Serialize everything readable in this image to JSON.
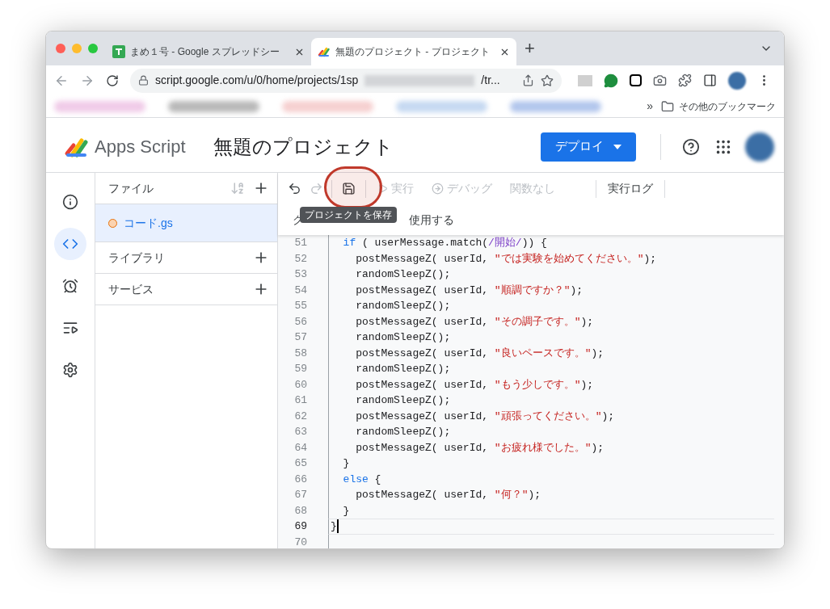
{
  "browser": {
    "tabs": [
      {
        "title": "まめ１号 - Google スプレッドシー",
        "kind": "sheets",
        "selected": false
      },
      {
        "title": "無題のプロジェクト - プロジェクト",
        "kind": "script",
        "selected": true
      }
    ],
    "new_tab": "+",
    "url_start": "script.google.com/u/0/home/projects/1sp",
    "url_end": "/tr...",
    "bookmarks_overflow": "»",
    "other_bookmarks": "その他のブックマーク"
  },
  "app": {
    "name": "Apps Script",
    "project_title": "無題のプロジェクト",
    "deploy_button": "デプロイ"
  },
  "rail": [
    {
      "kind": "overview",
      "selected": false
    },
    {
      "kind": "editor",
      "selected": true
    },
    {
      "kind": "triggers",
      "selected": false
    },
    {
      "kind": "executions",
      "selected": false
    },
    {
      "kind": "settings",
      "selected": false
    }
  ],
  "files": {
    "heading": "ファイル",
    "items": [
      {
        "name": "コード.gs",
        "selected": true
      }
    ],
    "sections": [
      "ライブラリ",
      "サービス"
    ]
  },
  "toolbar": {
    "actions": [
      {
        "kind": "undo",
        "disabled": false
      },
      {
        "kind": "redo",
        "disabled": true
      },
      {
        "kind": "save",
        "disabled": false
      }
    ],
    "run": {
      "label": "実行",
      "disabled": true
    },
    "debug": {
      "label": "デバッグ",
      "disabled": true
    },
    "function_select": "関数なし",
    "log_button": "実行ログ",
    "hint_start": "ク",
    "hint_end": "使用する",
    "tooltip": "プロジェクトを保存"
  },
  "code_lines": [
    {
      "number": "51",
      "current": false,
      "segments": [
        {
          "kind": "keyword",
          "text": "  if"
        },
        {
          "kind": "plain",
          "text": " ( userMessage.match("
        },
        {
          "kind": "regex",
          "text": "/開始/"
        },
        {
          "kind": "plain",
          "text": ")) {"
        }
      ]
    },
    {
      "number": "52",
      "current": false,
      "segments": [
        {
          "kind": "plain",
          "text": "    postMessageZ( userId, "
        },
        {
          "kind": "string",
          "text": "\"では実験を始めてください。\""
        },
        {
          "kind": "plain",
          "text": ");"
        }
      ]
    },
    {
      "number": "53",
      "current": false,
      "segments": [
        {
          "kind": "plain",
          "text": "    randomSleepZ();"
        }
      ]
    },
    {
      "number": "54",
      "current": false,
      "segments": [
        {
          "kind": "plain",
          "text": "    postMessageZ( userId, "
        },
        {
          "kind": "string",
          "text": "\"順調ですか？\""
        },
        {
          "kind": "plain",
          "text": ");"
        }
      ]
    },
    {
      "number": "55",
      "current": false,
      "segments": [
        {
          "kind": "plain",
          "text": "    randomSleepZ();"
        }
      ]
    },
    {
      "number": "56",
      "current": false,
      "segments": [
        {
          "kind": "plain",
          "text": "    postMessageZ( userId, "
        },
        {
          "kind": "string",
          "text": "\"その調子です。\""
        },
        {
          "kind": "plain",
          "text": ");"
        }
      ]
    },
    {
      "number": "57",
      "current": false,
      "segments": [
        {
          "kind": "plain",
          "text": "    randomSleepZ();"
        }
      ]
    },
    {
      "number": "58",
      "current": false,
      "segments": [
        {
          "kind": "plain",
          "text": "    postMessageZ( userId, "
        },
        {
          "kind": "string",
          "text": "\"良いペースです。\""
        },
        {
          "kind": "plain",
          "text": ");"
        }
      ]
    },
    {
      "number": "59",
      "current": false,
      "segments": [
        {
          "kind": "plain",
          "text": "    randomSleepZ();"
        }
      ]
    },
    {
      "number": "60",
      "current": false,
      "segments": [
        {
          "kind": "plain",
          "text": "    postMessageZ( userId, "
        },
        {
          "kind": "string",
          "text": "\"もう少しです。\""
        },
        {
          "kind": "plain",
          "text": ");"
        }
      ]
    },
    {
      "number": "61",
      "current": false,
      "segments": [
        {
          "kind": "plain",
          "text": "    randomSleepZ();"
        }
      ]
    },
    {
      "number": "62",
      "current": false,
      "segments": [
        {
          "kind": "plain",
          "text": "    postMessageZ( userId, "
        },
        {
          "kind": "string",
          "text": "\"頑張ってください。\""
        },
        {
          "kind": "plain",
          "text": ");"
        }
      ]
    },
    {
      "number": "63",
      "current": false,
      "segments": [
        {
          "kind": "plain",
          "text": "    randomSleepZ();"
        }
      ]
    },
    {
      "number": "64",
      "current": false,
      "segments": [
        {
          "kind": "plain",
          "text": "    postMessageZ( userId, "
        },
        {
          "kind": "string",
          "text": "\"お疲れ様でした。\""
        },
        {
          "kind": "plain",
          "text": ");"
        }
      ]
    },
    {
      "number": "65",
      "current": false,
      "segments": [
        {
          "kind": "plain",
          "text": "  }"
        }
      ]
    },
    {
      "number": "66",
      "current": false,
      "segments": [
        {
          "kind": "keyword",
          "text": "  else"
        },
        {
          "kind": "plain",
          "text": " {"
        }
      ]
    },
    {
      "number": "67",
      "current": false,
      "segments": [
        {
          "kind": "plain",
          "text": "    postMessageZ( userId, "
        },
        {
          "kind": "string",
          "text": "\"何？\""
        },
        {
          "kind": "plain",
          "text": ");"
        }
      ]
    },
    {
      "number": "68",
      "current": false,
      "segments": [
        {
          "kind": "plain",
          "text": "  }"
        }
      ]
    },
    {
      "number": "69",
      "current": true,
      "segments": [
        {
          "kind": "plain",
          "text": "}"
        }
      ]
    },
    {
      "number": "70",
      "current": false
    }
  ]
}
